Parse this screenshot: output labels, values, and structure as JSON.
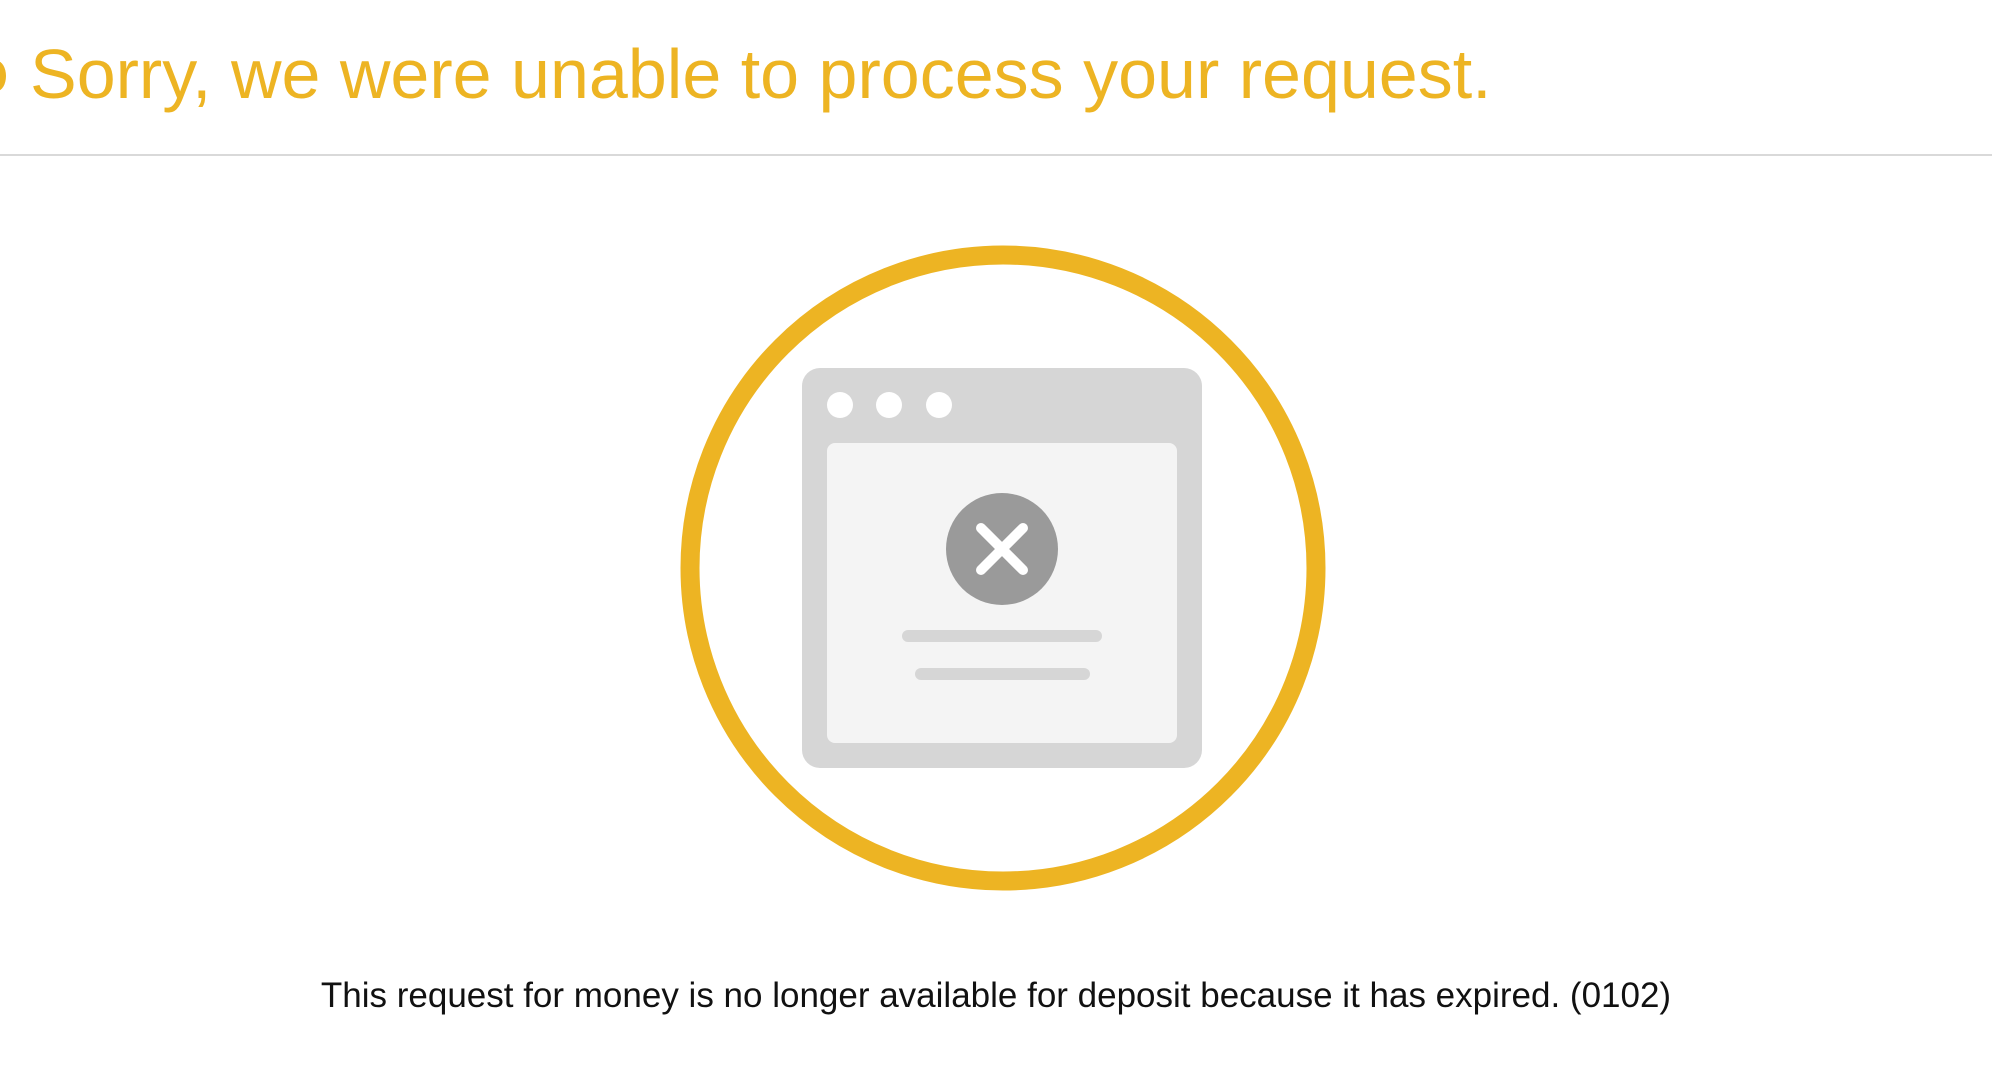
{
  "header": {
    "title": "Sorry, we were unable to process your request."
  },
  "illustration": {
    "icon": "browser-window-error-icon",
    "status_icon": "close-icon"
  },
  "message": {
    "text": "This request for money is no longer available for deposit because it has expired. (0102)"
  },
  "colors": {
    "accent": "#EDB423",
    "text": "#111111",
    "window_frame": "#D6D6D6",
    "window_content": "#F4F4F4",
    "error_badge": "#9A9A9A",
    "placeholder_line": "#D6D6D6"
  }
}
